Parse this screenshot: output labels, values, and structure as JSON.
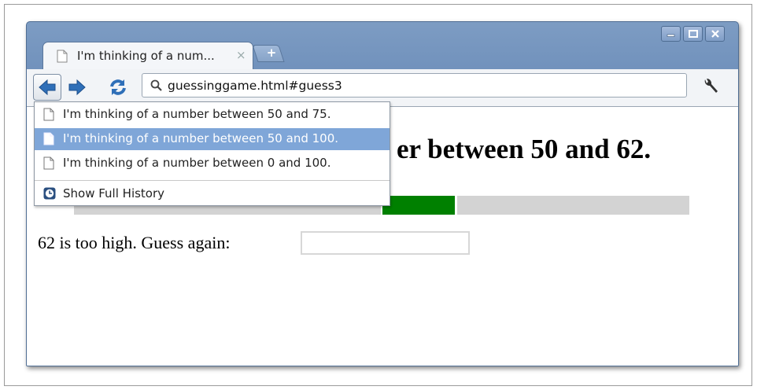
{
  "tab": {
    "title": "I'm thinking of a num...",
    "close_glyph": "×"
  },
  "newtab": {
    "label": "+"
  },
  "omnibox": {
    "url": "guessinggame.html#guess3"
  },
  "history": {
    "items": [
      {
        "label": "I'm thinking of a number between 50 and 75.",
        "selected": false
      },
      {
        "label": "I'm thinking of a number between 50 and 100.",
        "selected": true
      },
      {
        "label": "I'm thinking of a number between 0 and 100.",
        "selected": false
      }
    ],
    "show_full": "Show Full History"
  },
  "page": {
    "heading_visible": "er between 50 and 62.",
    "prompt": "62 is too high. Guess again:",
    "range": {
      "min": 0,
      "max": 100,
      "low": 50,
      "high": 62
    }
  },
  "colors": {
    "accent": "#008000",
    "selection": "#7fa6d8",
    "frame": "#7d9cc3"
  },
  "icons": [
    "page-icon",
    "back-arrow-icon",
    "forward-arrow-icon",
    "reload-icon",
    "search-icon",
    "wrench-icon",
    "clock-icon",
    "minimize-icon",
    "maximize-icon",
    "close-icon"
  ]
}
